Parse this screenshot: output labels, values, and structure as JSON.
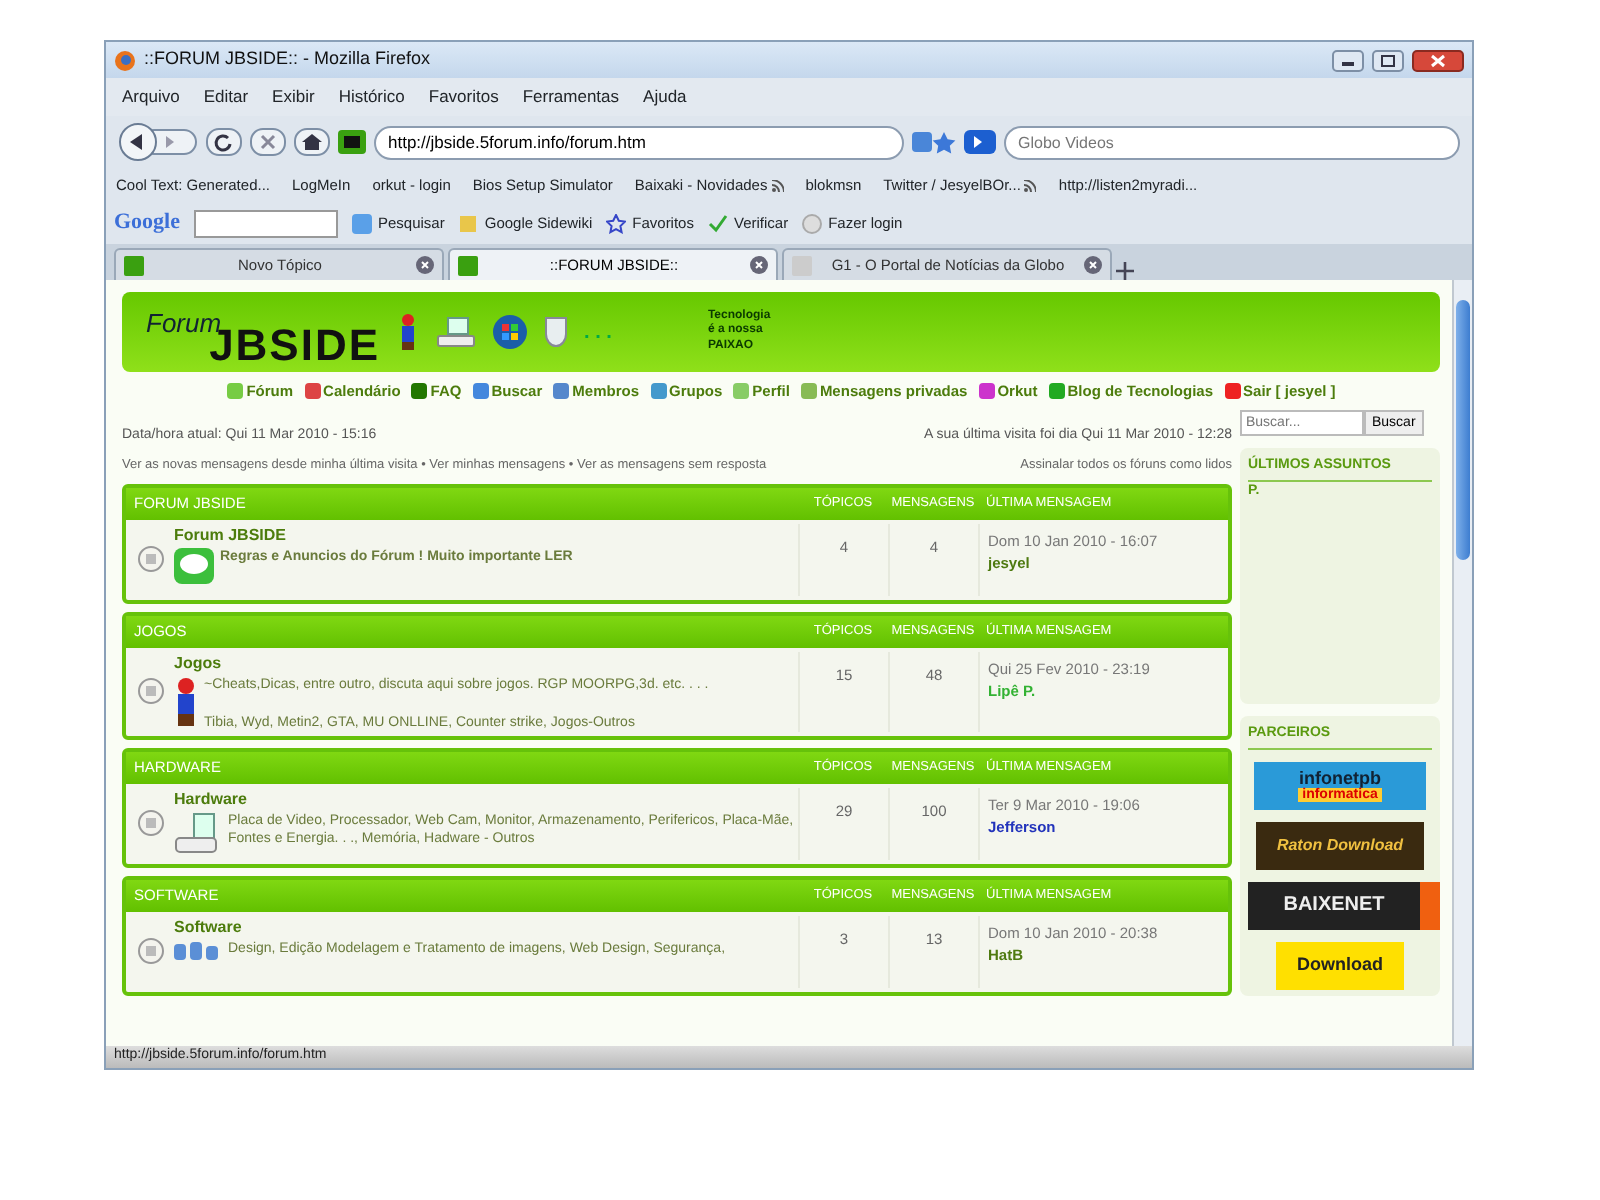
{
  "window": {
    "title": "::FORUM JBSIDE:: - Mozilla Firefox"
  },
  "menu": [
    "Arquivo",
    "Editar",
    "Exibir",
    "Histórico",
    "Favoritos",
    "Ferramentas",
    "Ajuda"
  ],
  "address_bar": {
    "url": "http://jbside.5forum.info/forum.htm"
  },
  "search_bar": {
    "placeholder": "Globo Videos"
  },
  "bookmarks": [
    {
      "label": "Cool Text: Generated...",
      "feed": false
    },
    {
      "label": "LogMeIn",
      "feed": false
    },
    {
      "label": "orkut - login",
      "feed": false
    },
    {
      "label": "Bios Setup Simulator",
      "feed": false
    },
    {
      "label": "Baixaki - Novidades",
      "feed": true
    },
    {
      "label": "blokmsn",
      "feed": false
    },
    {
      "label": "Twitter / JesyelBOr...",
      "feed": true
    },
    {
      "label": "http://listen2myradi...",
      "feed": false
    }
  ],
  "google_toolbar": {
    "logo": "Google",
    "items": [
      "Pesquisar",
      "Google Sidewiki",
      "Favoritos",
      "Verificar",
      "Fazer login"
    ]
  },
  "tabs": [
    {
      "label": "Novo Tópico",
      "selected": false
    },
    {
      "label": "::FORUM JBSIDE::",
      "selected": true
    },
    {
      "label": "G1 - O Portal de Notícias da Globo",
      "selected": false
    }
  ],
  "banner": {
    "forum_word": "Forum",
    "title": "JBSIDE",
    "dots": ". . .",
    "tagline": [
      "Tecnologia",
      "é a nossa",
      "PAIXAO"
    ]
  },
  "nav_links": [
    "Fórum",
    "Calendário",
    "FAQ",
    "Buscar",
    "Membros",
    "Grupos",
    "Perfil",
    "Mensagens privadas",
    "Orkut",
    "Blog de Tecnologias",
    "Sair [ jesyel ]"
  ],
  "side_search": {
    "placeholder": "Buscar...",
    "button": "Buscar"
  },
  "info": {
    "current_time": "Data/hora atual: Qui 11 Mar 2010 - 15:16",
    "last_visit": "A sua última visita foi dia Qui 11 Mar 2010 - 12:28",
    "separator": "•",
    "links": [
      "Ver as novas mensagens desde minha última visita",
      "Ver minhas mensagens",
      "Ver as mensagens sem resposta"
    ],
    "mark_read": "Assinalar todos os fóruns como lidos"
  },
  "categories": [
    {
      "title": "FORUM JBSIDE",
      "columns": [
        "TÓPICOS",
        "MENSAGENS",
        "ÚLTIMA MENSAGEM"
      ],
      "forums": [
        {
          "name": "Forum JBSIDE",
          "kind": "chat",
          "description": "Regras e Anuncios do Fórum ! Muito importante LER",
          "topics": "4",
          "posts": "4",
          "last_post_date": "Dom 10 Jan 2010 - 16:07",
          "last_post_author": "jesyel",
          "color": "#4e7a10"
        }
      ]
    },
    {
      "title": "JOGOS",
      "columns": [
        "TÓPICOS",
        "MENSAGENS",
        "ÚLTIMA MENSAGEM"
      ],
      "forums": [
        {
          "name": "Jogos",
          "kind": "mario",
          "description": "~Cheats,Dicas, entre outro, discuta aqui sobre jogos. RGP MOORPG,3d. etc. . . .",
          "subforums": "Tibia, Wyd, Metin2, GTA, MU ONLLINE, Counter strike, Jogos-Outros",
          "topics": "15",
          "posts": "48",
          "last_post_date": "Qui 25 Fev 2010 - 23:19",
          "last_post_author": "Lipê P.",
          "color": "#33b233"
        }
      ]
    },
    {
      "title": "HARDWARE",
      "columns": [
        "TÓPICOS",
        "MENSAGENS",
        "ÚLTIMA MENSAGEM"
      ],
      "forums": [
        {
          "name": "Hardware",
          "kind": "computer",
          "description": "Placa de Video, Processador, Web Cam, Monitor, Armazenamento, Perifericos, Placa-Mãe, Fontes e Energia. . ., Memória, Hadware - Outros",
          "topics": "29",
          "posts": "100",
          "last_post_date": "Ter 9 Mar 2010 - 19:06",
          "last_post_author": "Jefferson",
          "color": "#2233bb"
        }
      ]
    },
    {
      "title": "SOFTWARE",
      "columns": [
        "TÓPICOS",
        "MENSAGENS",
        "ÚLTIMA MENSAGEM"
      ],
      "forums": [
        {
          "name": "Software",
          "kind": "software",
          "description": "Design, Edição Modelagem e Tratamento de imagens, Web Design, Segurança,",
          "topics": "3",
          "posts": "13",
          "last_post_date": "Dom 10 Jan 2010 - 20:38",
          "last_post_author": "HatB",
          "color": "#4e7a10"
        }
      ]
    }
  ],
  "sidebar": {
    "latest": {
      "title": "ÚLTIMOS ASSUNTOS",
      "text": "P."
    },
    "partners": {
      "title": "PARCEIROS",
      "banners": [
        {
          "kind": "infonet",
          "text": "infonetpb",
          "subtext": "informatica"
        },
        {
          "kind": "raton",
          "text": "Raton Download"
        },
        {
          "kind": "baixenet",
          "text": "BAIXENET"
        },
        {
          "kind": "download",
          "text": "Download"
        }
      ]
    }
  },
  "status_bar": {
    "text": "http://jbside.5forum.info/forum.htm"
  }
}
